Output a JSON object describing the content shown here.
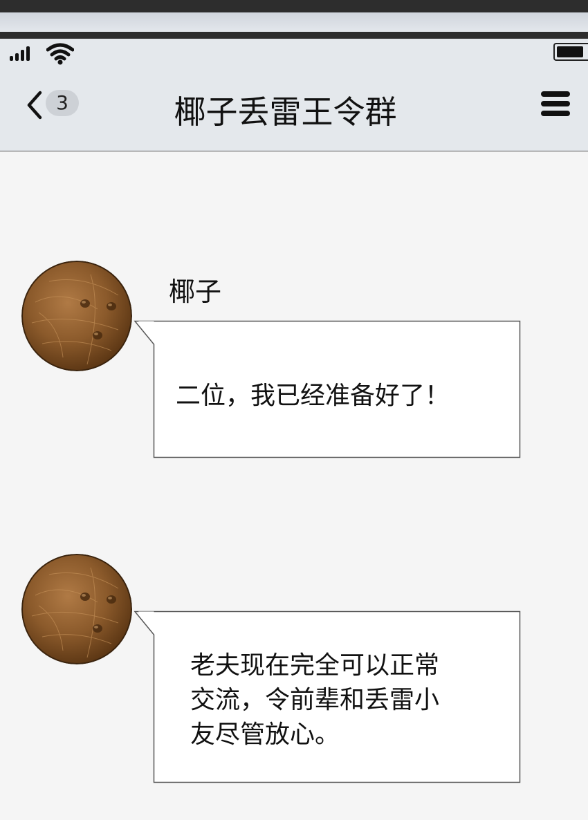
{
  "status_bar": {
    "signal_icon": "cellular-signal-icon",
    "wifi_icon": "wifi-icon",
    "battery_icon": "battery-icon",
    "battery_level": 0.9
  },
  "header": {
    "back_icon": "chevron-left-icon",
    "unread_count": "3",
    "title": "椰子丢雷王令群",
    "menu_icon": "hamburger-menu-icon"
  },
  "messages": [
    {
      "sender": "椰子",
      "avatar": "coconut-avatar",
      "text": "二位，我已经准备好了！"
    },
    {
      "sender": "",
      "avatar": "coconut-avatar",
      "lines": [
        "老夫现在完全可以正常",
        "交流，令前辈和丢雷小",
        "友尽管放心。"
      ]
    }
  ],
  "colors": {
    "page_bg": "#f5f5f5",
    "header_bg": "#e4e8ec",
    "bubble_bg": "#ffffff",
    "bubble_border": "#555555",
    "coconut_base": "#8b5a2b"
  }
}
